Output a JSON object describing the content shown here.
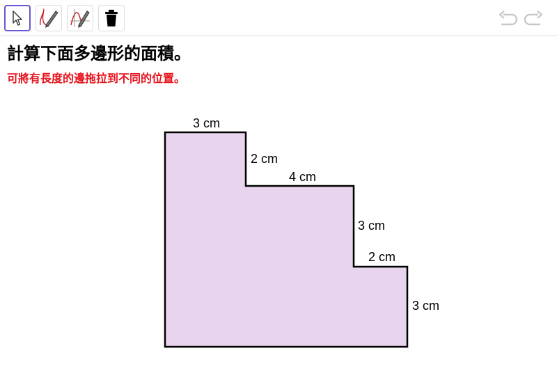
{
  "toolbar": {
    "tools": [
      {
        "name": "Move",
        "icon": "cursor-arrow-icon",
        "active": true
      },
      {
        "name": "Pen",
        "icon": "pen-icon",
        "active": false
      },
      {
        "name": "Freehand Shape",
        "icon": "freehand-shape-icon",
        "active": false
      },
      {
        "name": "Delete",
        "icon": "trash-icon",
        "active": false
      }
    ],
    "undo_icon": "undo-icon",
    "redo_icon": "redo-icon"
  },
  "question": {
    "title": "計算下面多邊形的面積。",
    "hint": "可將有長度的邊拖拉到不同的位置。"
  },
  "polygon": {
    "fill_color": "#e8d4ec",
    "stroke_color": "#000000",
    "edge_labels": {
      "top": "3 cm",
      "step1_vertical": "2 cm",
      "step1_horizontal": "4 cm",
      "step2_vertical": "3 cm",
      "step2_horizontal": "2 cm",
      "right_vertical": "3 cm"
    }
  },
  "colors": {
    "accent": "#6557d2",
    "hint_text": "#e8121c",
    "disabled_icon": "#c8c8c8"
  }
}
